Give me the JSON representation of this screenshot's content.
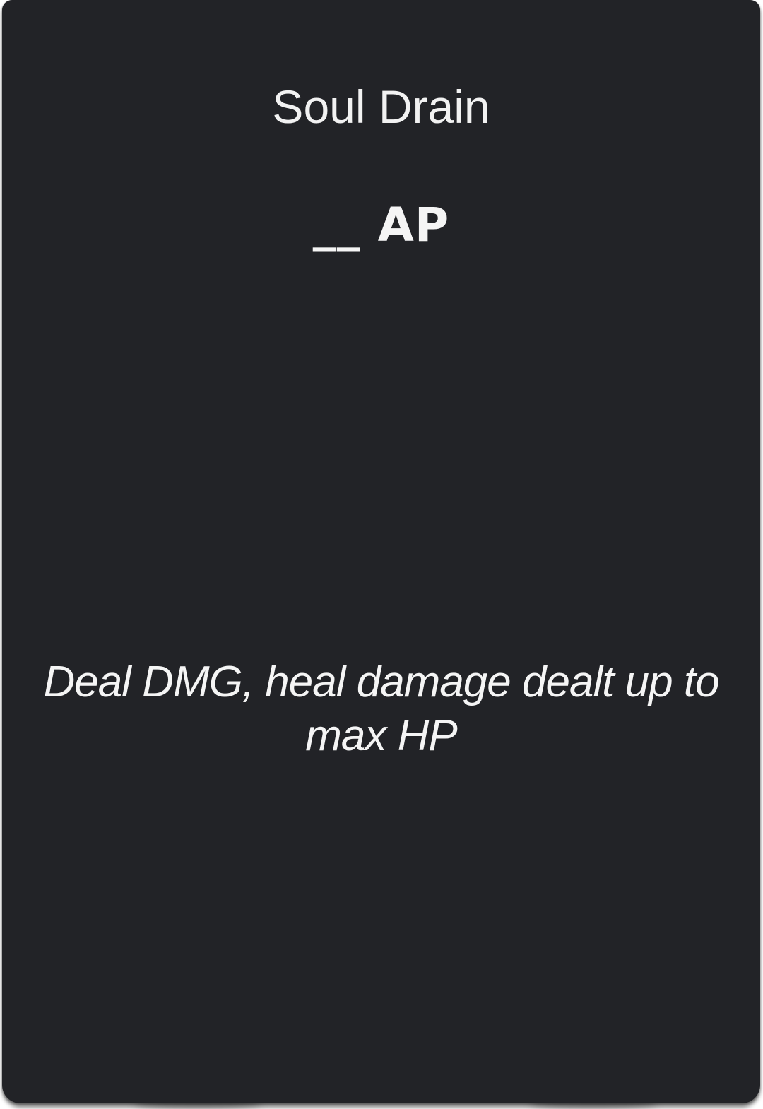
{
  "card": {
    "title": "Soul Drain",
    "cost": "__ AP",
    "description": "Deal DMG, heal damage dealt up to max HP"
  },
  "colors": {
    "card_background": "#222327",
    "text": "#f5f5f5"
  }
}
